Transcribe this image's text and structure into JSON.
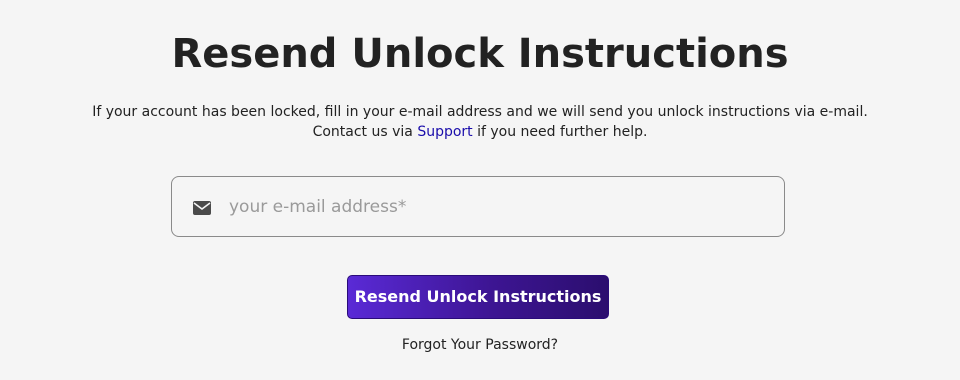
{
  "page": {
    "title": "Resend Unlock Instructions"
  },
  "description": {
    "line1": "If your account has been locked, fill in your e-mail address and we will send you unlock instructions via e-mail.",
    "line2_prefix": "Contact us via ",
    "support_link": "Support",
    "line2_suffix": " if you need further help."
  },
  "form": {
    "email_icon": "envelope-icon",
    "email_placeholder": "your e-mail address*",
    "email_value": "",
    "submit_label": "Resend Unlock Instructions"
  },
  "links": {
    "forgot_password": "Forgot Your Password?"
  },
  "colors": {
    "background": "#f5f5f5",
    "text": "#222222",
    "link": "#1a0dab",
    "button_gradient_start": "#5a2ad6",
    "button_gradient_end": "#2b0e6e",
    "button_text": "#ffffff",
    "placeholder": "#9a9a9a"
  }
}
